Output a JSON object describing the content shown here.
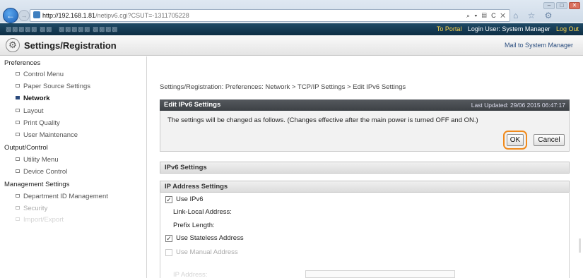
{
  "browser": {
    "url_host": "http://192.168.1.81",
    "url_path": "/netipv6.cgi?CSUT=-1311705228",
    "address_tools": "⌕ ▾ ▤ C ✕",
    "nav_back": "←",
    "nav_fwd": "→",
    "toolbar_icons": "⌂ ☆ ⚙",
    "window_buttons": [
      "–",
      "□",
      "✕"
    ]
  },
  "topbar": {
    "to_portal": "To Portal",
    "login_user": "Login User: System Manager",
    "logout": "Log Out"
  },
  "header": {
    "title": "Settings/Registration",
    "icon": "gear-icon",
    "icon_glyph": "⚙",
    "mail_link": "Mail to System Manager"
  },
  "sidebar": {
    "sections": [
      {
        "label": "Preferences",
        "items": [
          {
            "label": "Control Menu",
            "active": false
          },
          {
            "label": "Paper Source Settings",
            "active": false
          },
          {
            "label": "Network",
            "active": true
          },
          {
            "label": "Layout",
            "active": false
          },
          {
            "label": "Print Quality",
            "active": false
          },
          {
            "label": "User Maintenance",
            "active": false
          }
        ]
      },
      {
        "label": "Output/Control",
        "items": [
          {
            "label": "Utility Menu",
            "active": false
          },
          {
            "label": "Device Control",
            "active": false
          }
        ]
      },
      {
        "label": "Management Settings",
        "items": [
          {
            "label": "Department ID Management",
            "active": false
          },
          {
            "label": "Security",
            "active": false
          },
          {
            "label": "Import/Export",
            "active": false
          }
        ]
      }
    ]
  },
  "main": {
    "breadcrumb": "Settings/Registration: Preferences: Network > TCP/IP Settings > Edit IPv6 Settings",
    "panel_title": "Edit IPv6 Settings",
    "last_updated": "Last Updated: 29/06 2015 06:47:17",
    "message": "The settings will be changed as follows. (Changes effective after the main power is turned OFF and ON.)",
    "ok_label": "OK",
    "cancel_label": "Cancel",
    "section_ipv6": "IPv6 Settings",
    "section_ip_address": "IP Address Settings",
    "use_ipv6": {
      "label": "Use IPv6",
      "checked": true
    },
    "link_local_label": "Link-Local Address:",
    "prefix_length_label": "Prefix Length:",
    "use_stateless": {
      "label": "Use Stateless Address",
      "checked": true
    },
    "use_manual": {
      "label": "Use Manual Address",
      "checked": false
    },
    "ip_address_label": "IP Address:",
    "check_glyph": "✓"
  }
}
